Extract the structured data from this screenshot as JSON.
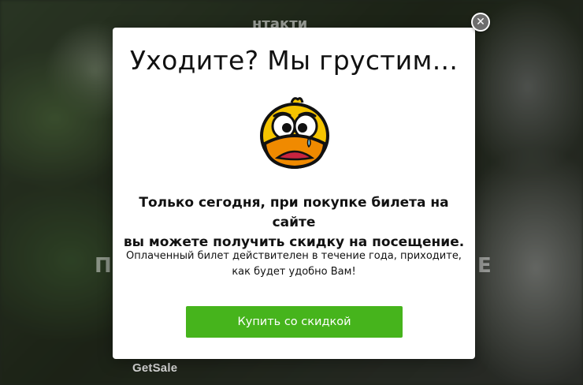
{
  "background": {
    "title_fragment": "нтакти",
    "subtitle_left": "П",
    "subtitle_right": "Е",
    "brand": "GetSale"
  },
  "popup": {
    "close_label": "✕",
    "heading": "Уходите? Мы грустим...",
    "image_icon": "sad-duck-icon",
    "offer_line1": "Только сегодня, при покупке билета на сайте",
    "offer_line2": "вы можете получить скидку на посещение.",
    "note_line1": "Оплаченный билет действителен в течение года, приходите,",
    "note_line2": "как будет удобно Вам!",
    "cta_label": "Купить со скидкой"
  },
  "colors": {
    "cta": "#46b41c",
    "close_bg": "#6d6d6d",
    "duck_yellow": "#f5c400",
    "duck_beak": "#f08a00"
  }
}
